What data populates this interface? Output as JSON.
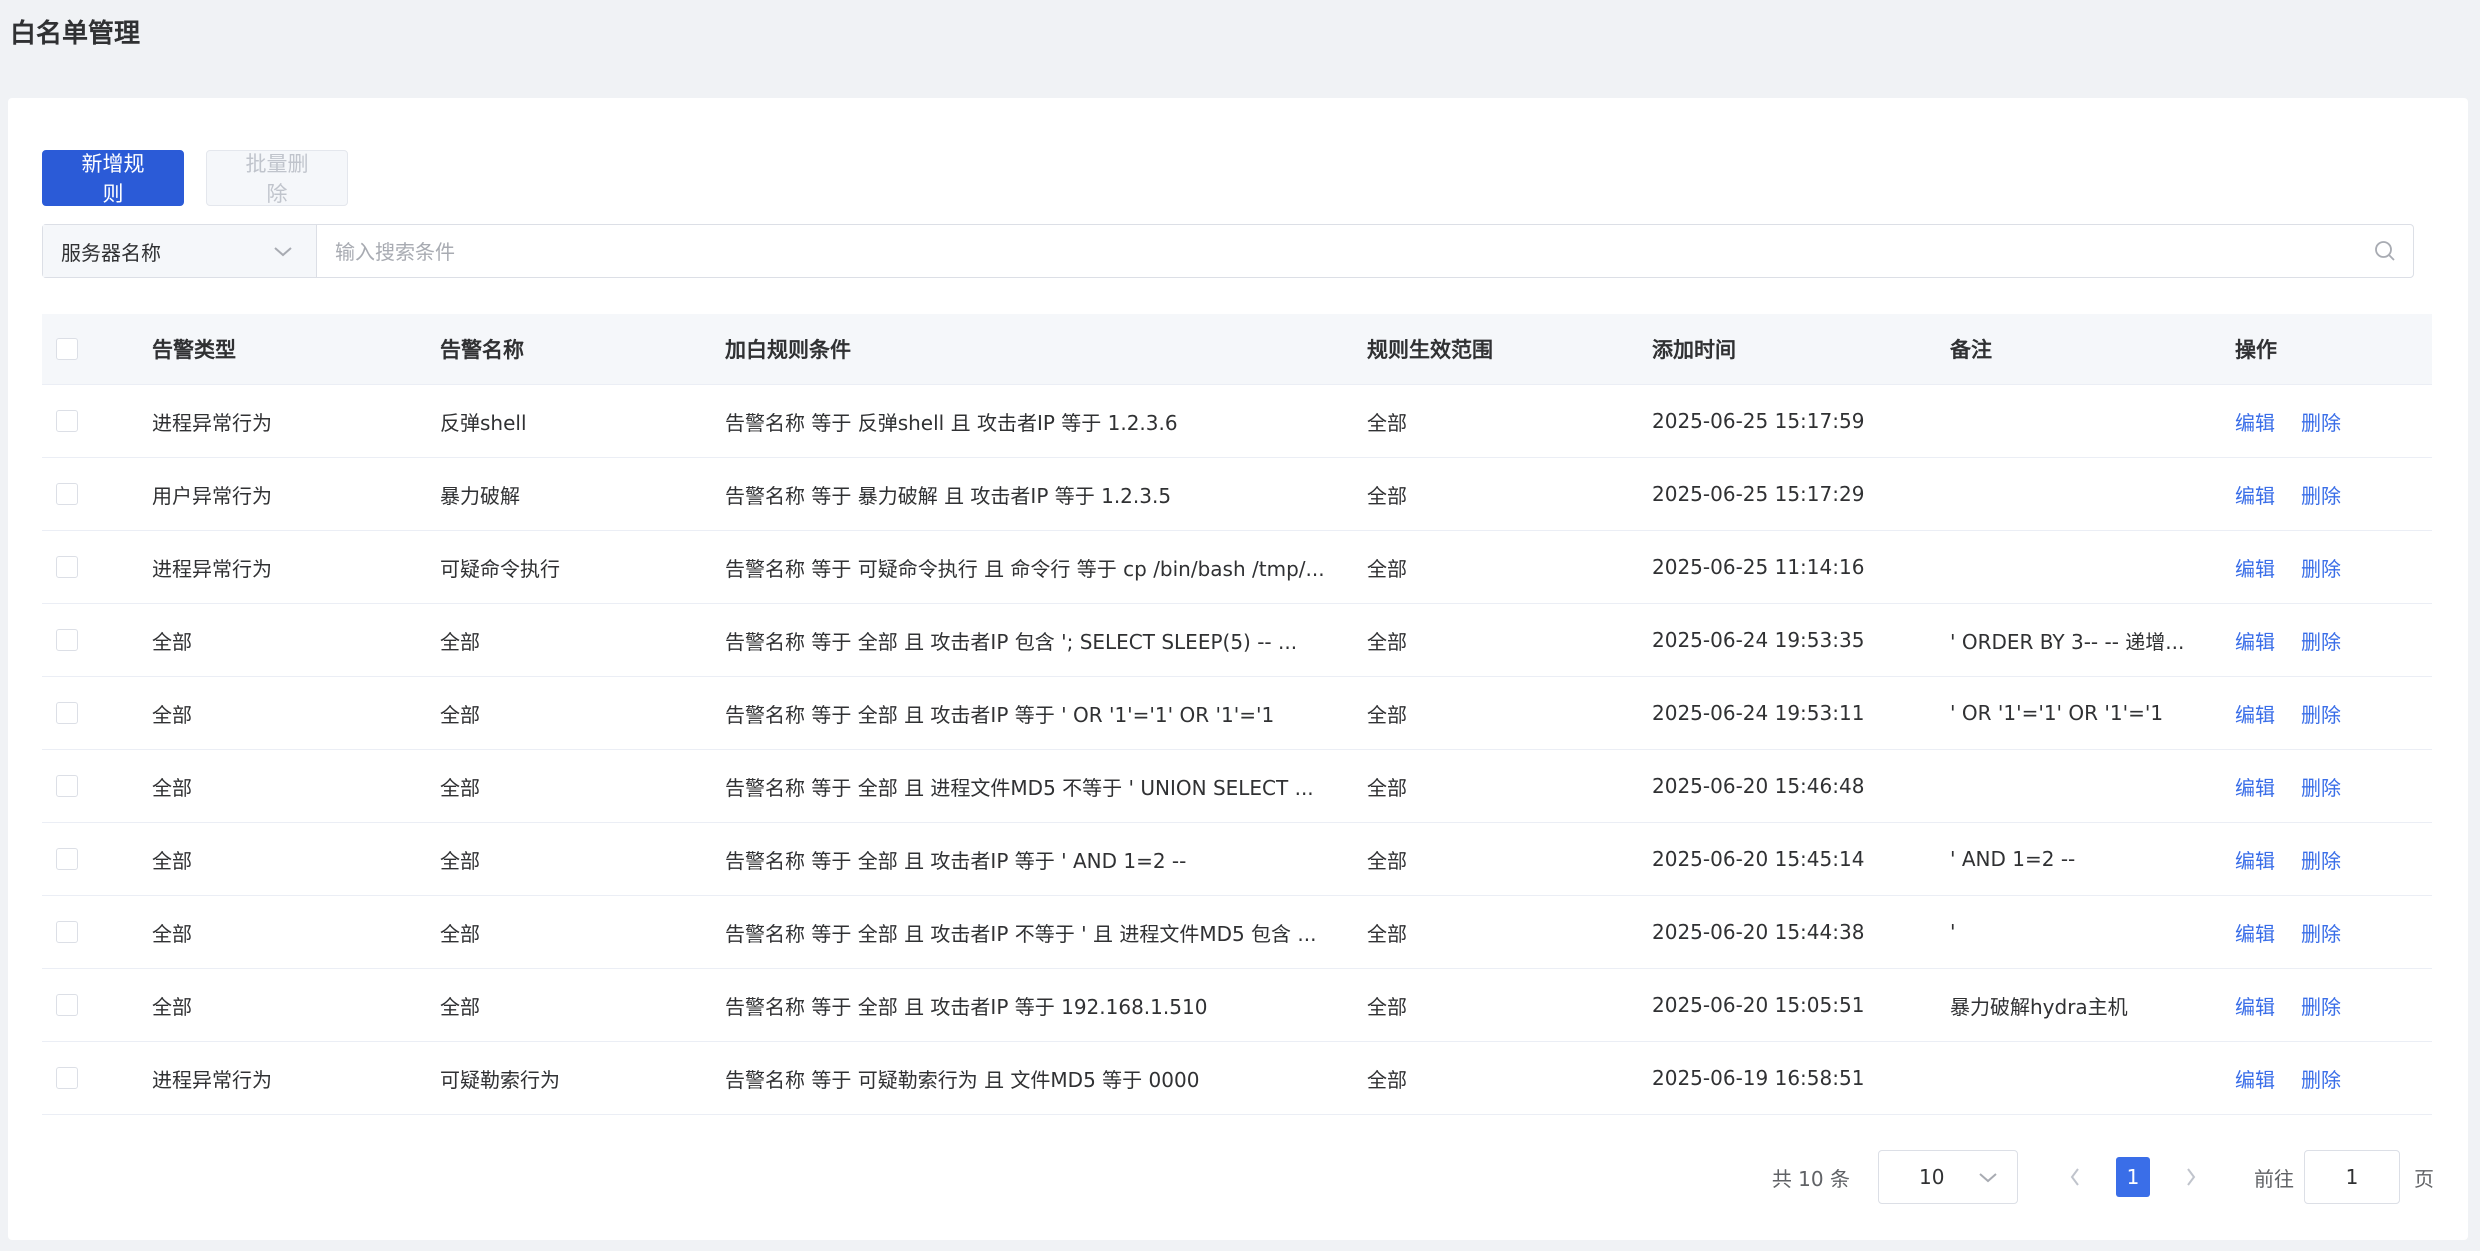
{
  "page": {
    "title": "白名单管理"
  },
  "toolbar": {
    "add_label": "新增规则",
    "batch_delete_label": "批量删除"
  },
  "search": {
    "field_selected": "服务器名称",
    "placeholder": "输入搜索条件",
    "value": ""
  },
  "table": {
    "columns": [
      "告警类型",
      "告警名称",
      "加白规则条件",
      "规则生效范围",
      "添加时间",
      "备注",
      "操作"
    ],
    "rows": [
      {
        "type": "进程异常行为",
        "name": "反弹shell",
        "condition": "告警名称 等于 反弹shell 且 攻击者IP 等于 1.2.3.6",
        "scope": "全部",
        "time": "2025-06-25 15:17:59",
        "remark": ""
      },
      {
        "type": "用户异常行为",
        "name": "暴力破解",
        "condition": "告警名称 等于 暴力破解 且 攻击者IP 等于 1.2.3.5",
        "scope": "全部",
        "time": "2025-06-25 15:17:29",
        "remark": ""
      },
      {
        "type": "进程异常行为",
        "name": "可疑命令执行",
        "condition": "告警名称 等于 可疑命令执行 且 命令行 等于 cp /bin/bash /tmp/...",
        "scope": "全部",
        "time": "2025-06-25 11:14:16",
        "remark": ""
      },
      {
        "type": "全部",
        "name": "全部",
        "condition": "告警名称 等于 全部 且 攻击者IP 包含 '; SELECT SLEEP(5) -- ...",
        "scope": "全部",
        "time": "2025-06-24 19:53:35",
        "remark": "' ORDER BY 3-- -- 递增..."
      },
      {
        "type": "全部",
        "name": "全部",
        "condition": "告警名称 等于 全部 且 攻击者IP 等于 ' OR '1'='1' OR '1'='1",
        "scope": "全部",
        "time": "2025-06-24 19:53:11",
        "remark": "' OR '1'='1' OR '1'='1"
      },
      {
        "type": "全部",
        "name": "全部",
        "condition": "告警名称 等于 全部 且 进程文件MD5 不等于 ' UNION SELECT ...",
        "scope": "全部",
        "time": "2025-06-20 15:46:48",
        "remark": ""
      },
      {
        "type": "全部",
        "name": "全部",
        "condition": "告警名称 等于 全部 且 攻击者IP 等于 ' AND 1=2 --",
        "scope": "全部",
        "time": "2025-06-20 15:45:14",
        "remark": "' AND 1=2 --"
      },
      {
        "type": "全部",
        "name": "全部",
        "condition": "告警名称 等于 全部 且 攻击者IP 不等于 ' 且 进程文件MD5 包含 ...",
        "scope": "全部",
        "time": "2025-06-20 15:44:38",
        "remark": "'"
      },
      {
        "type": "全部",
        "name": "全部",
        "condition": "告警名称 等于 全部 且 攻击者IP 等于 192.168.1.510",
        "scope": "全部",
        "time": "2025-06-20 15:05:51",
        "remark": "暴力破解hydra主机"
      },
      {
        "type": "进程异常行为",
        "name": "可疑勒索行为",
        "condition": "告警名称 等于 可疑勒索行为 且 文件MD5 等于 0000",
        "scope": "全部",
        "time": "2025-06-19 16:58:51",
        "remark": ""
      }
    ],
    "actions": {
      "edit": "编辑",
      "delete": "删除"
    }
  },
  "pagination": {
    "total_text": "共 10 条",
    "page_size": "10",
    "current_page": "1",
    "goto_label": "前往",
    "goto_value": "1",
    "page_suffix": "页"
  },
  "colors": {
    "primary": "#2b5bd7",
    "link": "#3a6ee8",
    "background": "#f0f2f5",
    "header_bg": "#f5f7fa"
  },
  "icons": {
    "select_chevron": "chevron-down-icon",
    "search": "search-icon",
    "prev": "chevron-left-icon",
    "next": "chevron-right-icon"
  }
}
